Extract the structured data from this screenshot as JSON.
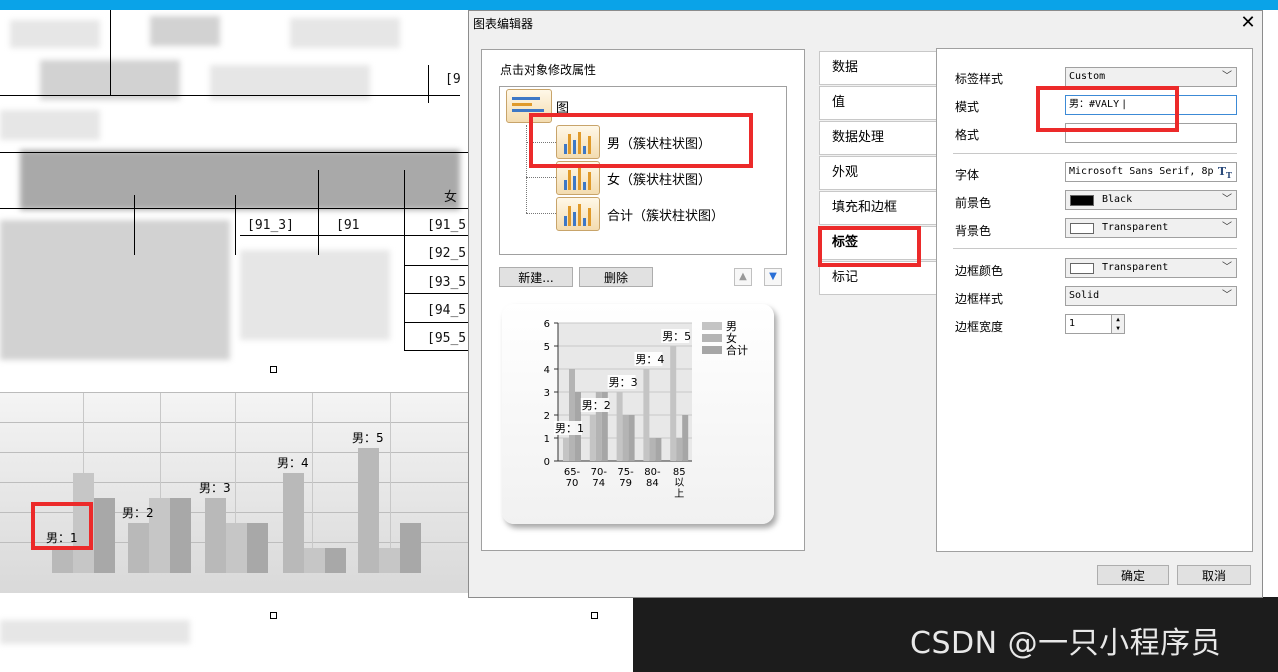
{
  "dialog": {
    "title": "图表编辑器",
    "close_symbol": "✕",
    "tree_hint": "点击对象修改属性",
    "tree": {
      "root": "图",
      "children": [
        "男（簇状柱状图）",
        "女（簇状柱状图）",
        "合计（簇状柱状图）"
      ]
    },
    "new_button": "新建...",
    "delete_button": "删除",
    "tabs": [
      "数据",
      "值",
      "数据处理",
      "外观",
      "填充和边框",
      "标签",
      "标记"
    ],
    "active_tab": "标签",
    "properties": {
      "label_style": {
        "label": "标签样式",
        "value": "Custom"
      },
      "pattern": {
        "label": "模式",
        "value": "男：#VALY"
      },
      "format": {
        "label": "格式",
        "value": ""
      },
      "font": {
        "label": "字体",
        "value": "Microsoft Sans Serif, 8p"
      },
      "fore_color": {
        "label": "前景色",
        "value": "Black",
        "swatch": "#000000"
      },
      "back_color": {
        "label": "背景色",
        "value": "Transparent",
        "swatch": "#ffffff"
      },
      "border_color": {
        "label": "边框颜色",
        "value": "Transparent",
        "swatch": "#ffffff"
      },
      "border_style": {
        "label": "边框样式",
        "value": "Solid"
      },
      "border_width": {
        "label": "边框宽度",
        "value": "1"
      }
    },
    "ok_button": "确定",
    "cancel_button": "取消"
  },
  "preview_chart": {
    "legend": [
      "男",
      "女",
      "合计"
    ],
    "y_ticks": [
      "0",
      "1",
      "2",
      "3",
      "4",
      "5",
      "6"
    ],
    "x_labels": [
      [
        "65-",
        "70"
      ],
      [
        "70-",
        "74"
      ],
      [
        "75-",
        "79"
      ],
      [
        "80-",
        "84"
      ],
      [
        "85",
        "以",
        "上"
      ]
    ],
    "data_labels": [
      "男：1",
      "男：2",
      "男：3",
      "男：4",
      "男：5"
    ]
  },
  "background": {
    "cells": [
      "[91_3]",
      "[91",
      "[91_5",
      "[92_5",
      "[93_5",
      "[94_5",
      "[95_5",
      "女",
      "[9"
    ],
    "chart_labels": [
      "男：1",
      "男：2",
      "男：3",
      "男：4",
      "男：5"
    ]
  },
  "chart_data": {
    "type": "bar",
    "categories": [
      "65-70",
      "70-74",
      "75-79",
      "80-84",
      "85以上"
    ],
    "series": [
      {
        "name": "男",
        "values": [
          1,
          2,
          3,
          4,
          5
        ]
      },
      {
        "name": "女",
        "values": [
          4,
          3,
          2,
          1,
          1
        ]
      },
      {
        "name": "合计",
        "values": [
          3,
          3,
          2,
          1,
          2
        ]
      }
    ],
    "ylim": [
      0,
      6
    ],
    "legend_position": "top-right"
  },
  "watermark": "CSDN @一只小程序员",
  "colors": {
    "highlight": "#ec2a2a",
    "title_bar": "#0aa3e8"
  }
}
